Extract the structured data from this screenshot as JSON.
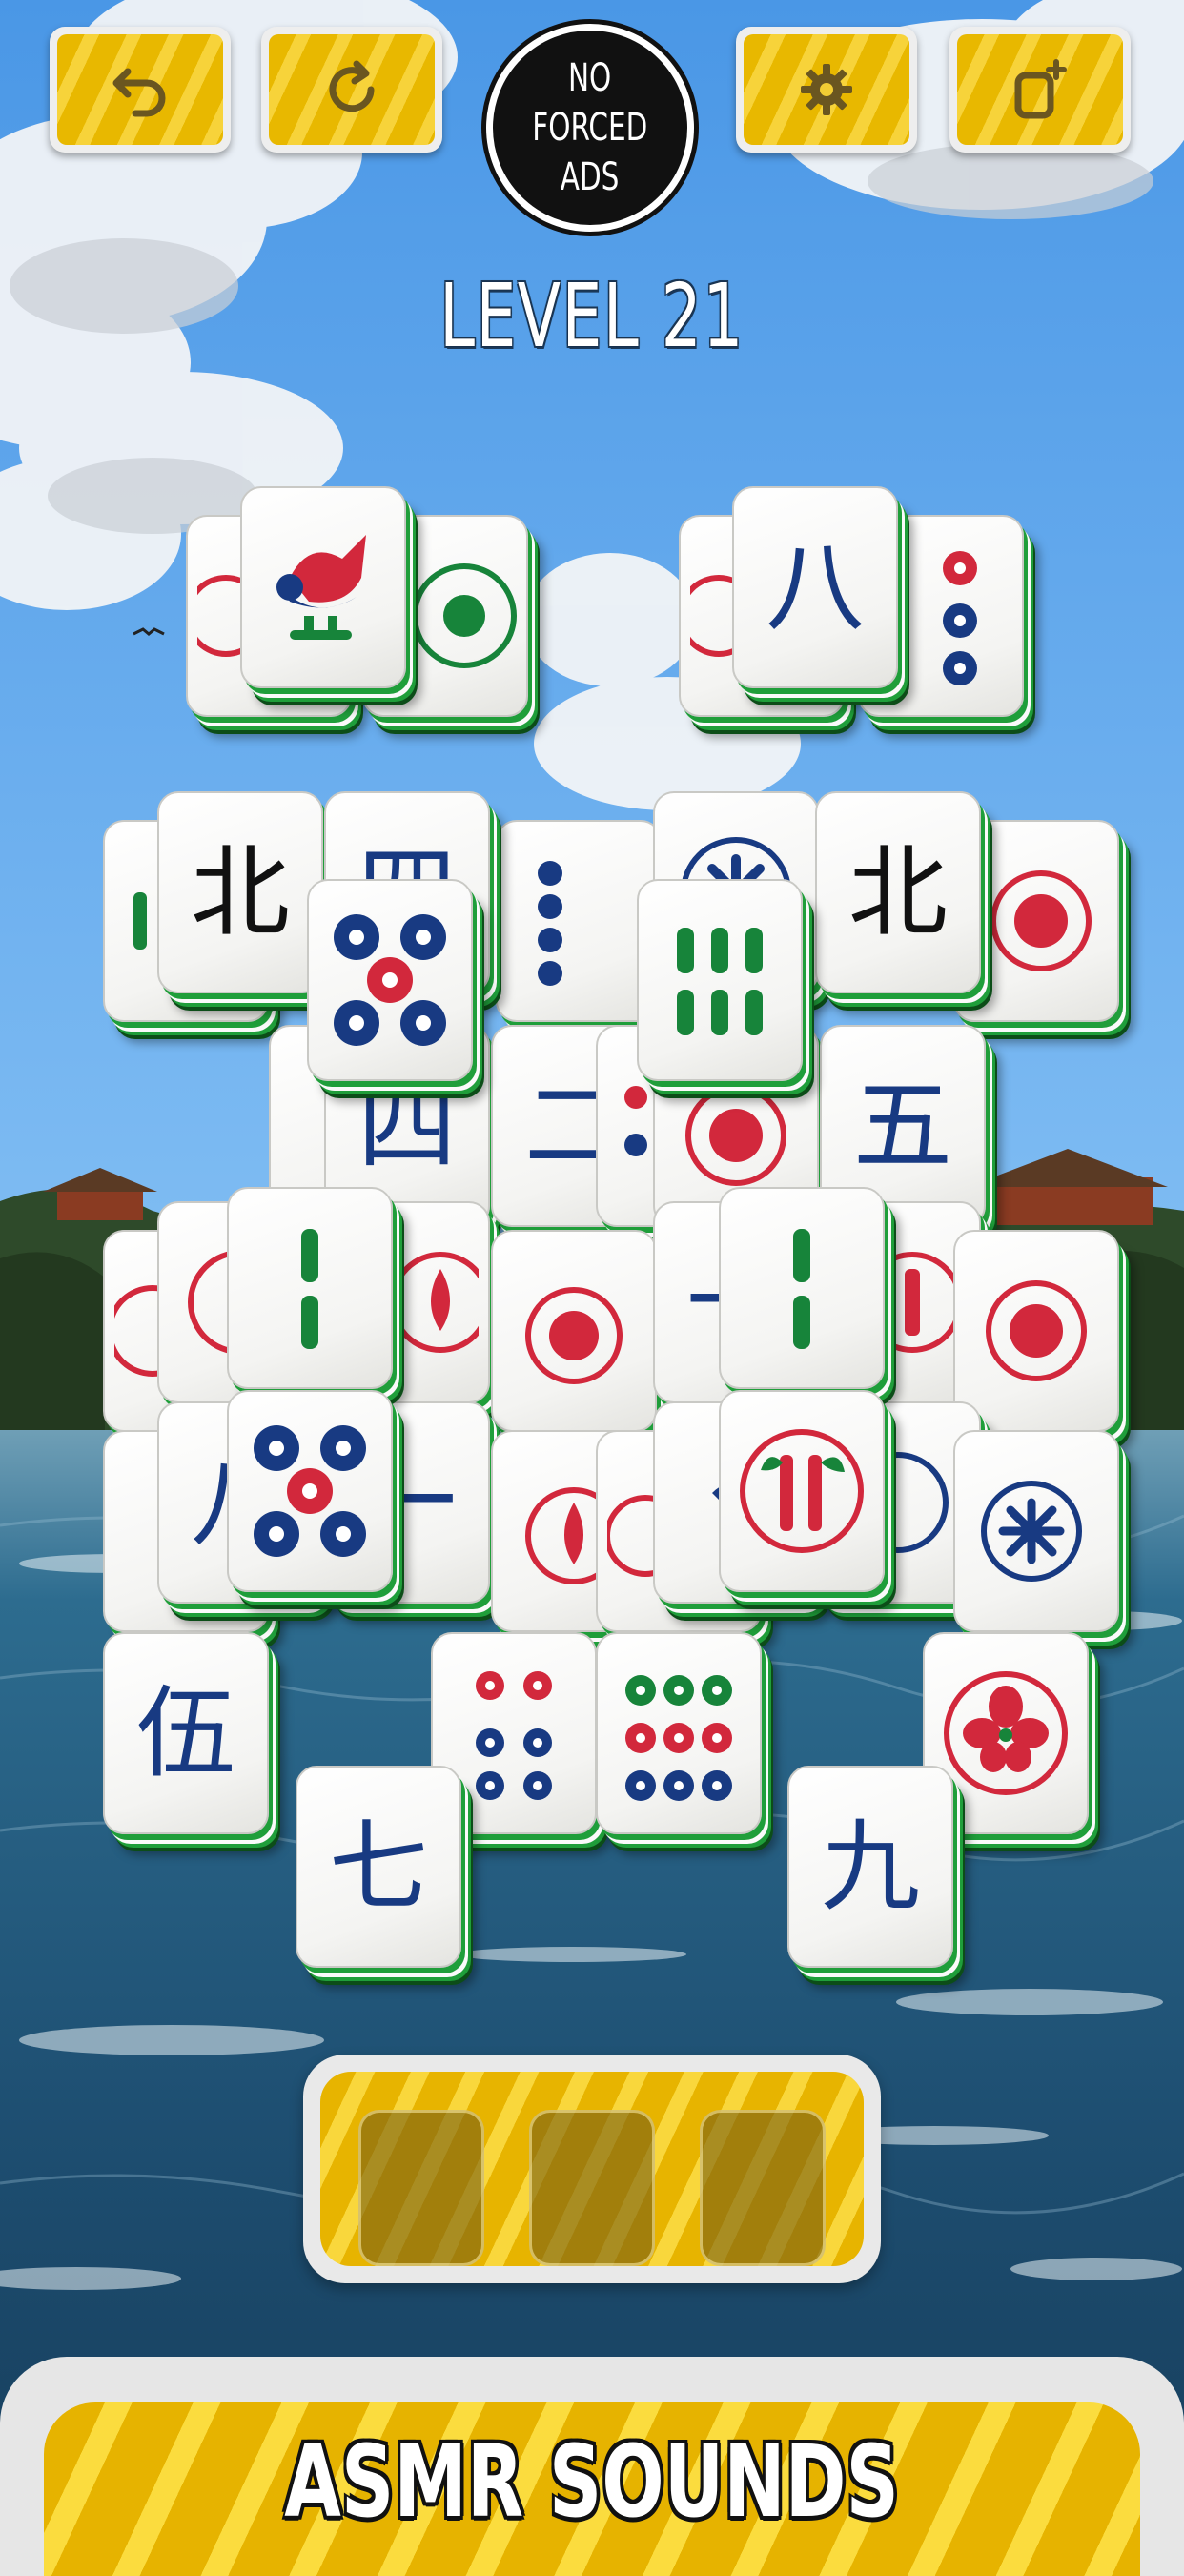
{
  "game": {
    "badge_lines": [
      "NO",
      "FORCED",
      "ADS"
    ],
    "level_label": "LEVEL 21",
    "promo_banner": "ASMR SOUNDS",
    "tray_slots": 3
  },
  "toolbar": [
    {
      "name": "undo-button",
      "icon": "undo-arrow-icon"
    },
    {
      "name": "restart-button",
      "icon": "refresh-icon"
    },
    {
      "name": "settings-button",
      "icon": "gear-icon"
    },
    {
      "name": "add-tiles-button",
      "icon": "add-tile-icon"
    }
  ],
  "tiles": {
    "characters": [
      "八",
      "北",
      "北",
      "四",
      "二",
      "五",
      "伍",
      "七",
      "九",
      "一",
      "一",
      "八"
    ]
  },
  "colors": {
    "tile_edge": "#1f9e3a",
    "button_yellow": "#f7d33a",
    "tile_red": "#d2283c",
    "tile_blue": "#183a82",
    "tile_green": "#17843a"
  }
}
